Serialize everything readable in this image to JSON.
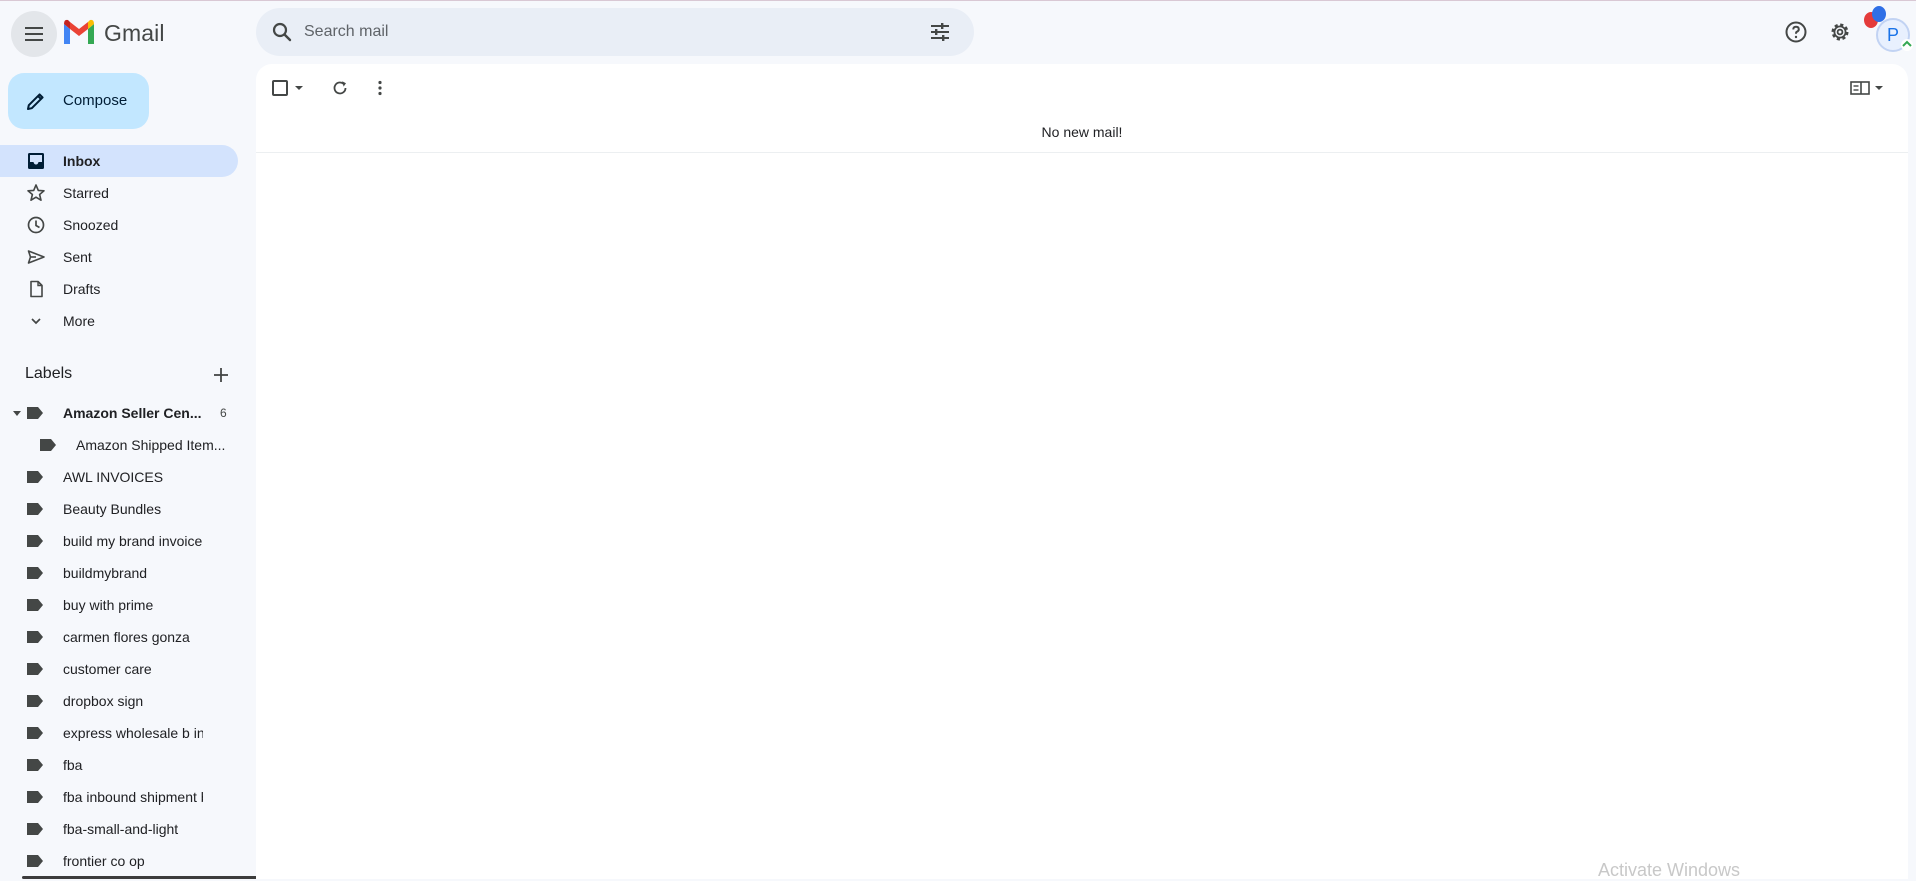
{
  "app": {
    "name": "Gmail"
  },
  "search": {
    "placeholder": "Search mail"
  },
  "compose": {
    "label": "Compose"
  },
  "nav": {
    "items": [
      {
        "label": "Inbox"
      },
      {
        "label": "Starred"
      },
      {
        "label": "Snoozed"
      },
      {
        "label": "Sent"
      },
      {
        "label": "Drafts"
      },
      {
        "label": "More"
      }
    ]
  },
  "labels": {
    "heading": "Labels",
    "items": [
      {
        "label": "Amazon Seller Cen...",
        "count": "6"
      },
      {
        "label": "Amazon Shipped Item..."
      },
      {
        "label": "AWL INVOICES"
      },
      {
        "label": "Beauty Bundles"
      },
      {
        "label": "build my brand invoice"
      },
      {
        "label": "buildmybrand"
      },
      {
        "label": "buy with prime"
      },
      {
        "label": "carmen flores gonza"
      },
      {
        "label": "customer care"
      },
      {
        "label": "dropbox sign"
      },
      {
        "label": "express wholesale b inv..."
      },
      {
        "label": "fba"
      },
      {
        "label": "fba inbound shipment b..."
      },
      {
        "label": "fba-small-and-light"
      },
      {
        "label": "frontier co op"
      }
    ]
  },
  "avatar": {
    "initial": "P"
  },
  "main": {
    "empty_message": "No new mail!"
  },
  "watermark": {
    "text": "Activate Windows"
  },
  "colors": {
    "background": "#f6f8fc",
    "compose": "#c2e7ff",
    "active_nav": "#d3e3fd",
    "search": "#e9eef6"
  }
}
